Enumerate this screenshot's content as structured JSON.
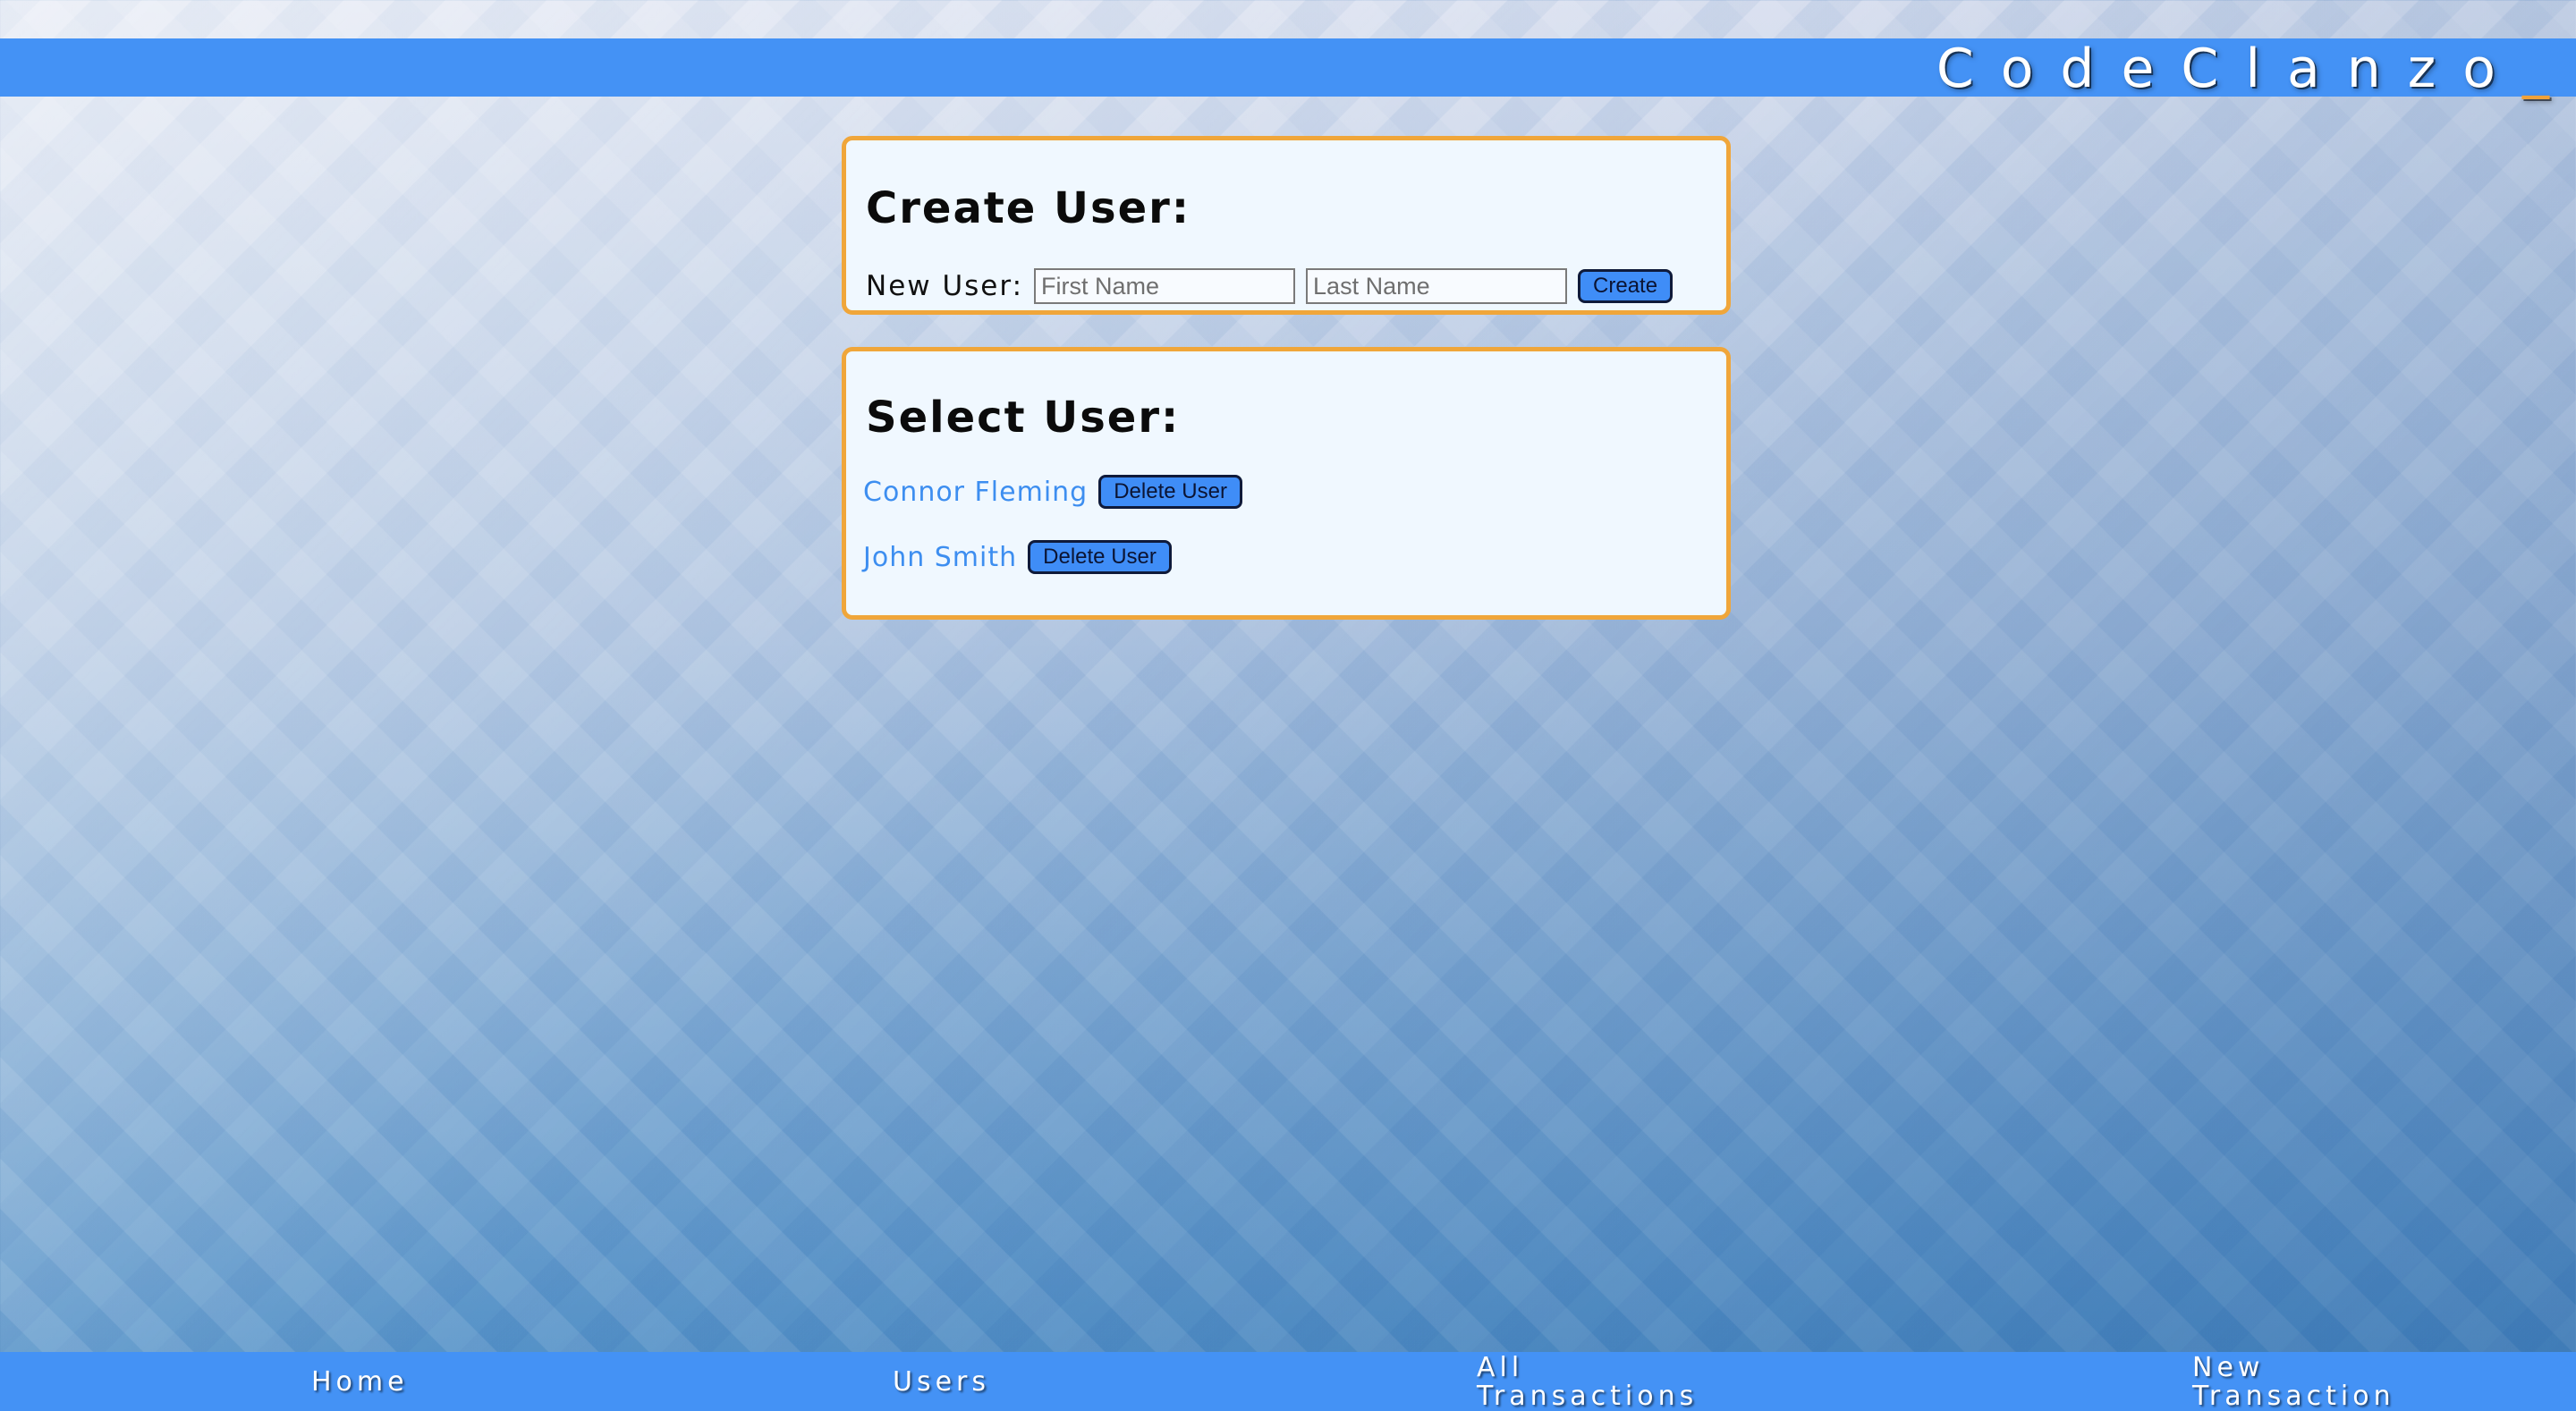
{
  "header": {
    "brand": "CodeClanzo",
    "brand_cursor": "_"
  },
  "create_user": {
    "title": "Create User:",
    "new_user_label": "New User:",
    "first_name_placeholder": "First Name",
    "first_name_value": "",
    "last_name_placeholder": "Last Name",
    "last_name_value": "",
    "create_button": "Create"
  },
  "select_user": {
    "title": "Select User:",
    "users": [
      {
        "name": "Connor Fleming",
        "delete_label": "Delete User"
      },
      {
        "name": "John Smith",
        "delete_label": "Delete User"
      }
    ]
  },
  "footer": {
    "nav": [
      {
        "label_lines": [
          "Home"
        ]
      },
      {
        "label_lines": [
          "Users"
        ]
      },
      {
        "label_lines": [
          "All",
          "Transactions"
        ]
      },
      {
        "label_lines": [
          "New",
          "Transaction"
        ]
      }
    ]
  },
  "colors": {
    "bar_blue": "#4492f5",
    "card_border_orange": "#f0a63a",
    "card_background": "#f0f8ff",
    "link_blue": "#3d8ef0",
    "button_blue": "#3f8df7"
  }
}
